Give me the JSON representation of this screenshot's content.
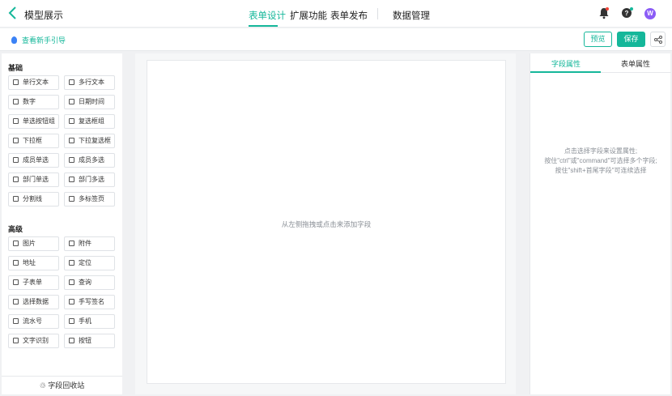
{
  "header": {
    "title": "模型展示",
    "nav": [
      "表单设计",
      "扩展功能",
      "表单发布",
      "数据管理"
    ],
    "avatar": "W"
  },
  "toolbar": {
    "guide": "查看新手引导",
    "preview": "预览",
    "save": "保存"
  },
  "left": {
    "basic_title": "基础",
    "basic": [
      "单行文本",
      "多行文本",
      "数字",
      "日期时间",
      "单选按钮组",
      "复选框组",
      "下拉框",
      "下拉复选框",
      "成员单选",
      "成员多选",
      "部门单选",
      "部门多选",
      "分割线",
      "多标签页"
    ],
    "advanced_title": "高级",
    "advanced": [
      "图片",
      "附件",
      "地址",
      "定位",
      "子表单",
      "查询",
      "选择数据",
      "手写签名",
      "流水号",
      "手机",
      "文字识别",
      "按钮"
    ],
    "recycle": "字段回收站"
  },
  "canvas": {
    "hint": "从左侧拖拽或点击来添加字段"
  },
  "right": {
    "tabs": [
      "字段属性",
      "表单属性"
    ],
    "hint1": "点击选择字段来设置属性;",
    "hint2": "按住\"ctrl\"或\"command\"可选择多个字段;",
    "hint3": "按住\"shift+首尾字段\"可连续选择"
  },
  "colors": {
    "accent": "#15b79a",
    "avatar": "#8b5cf6"
  }
}
